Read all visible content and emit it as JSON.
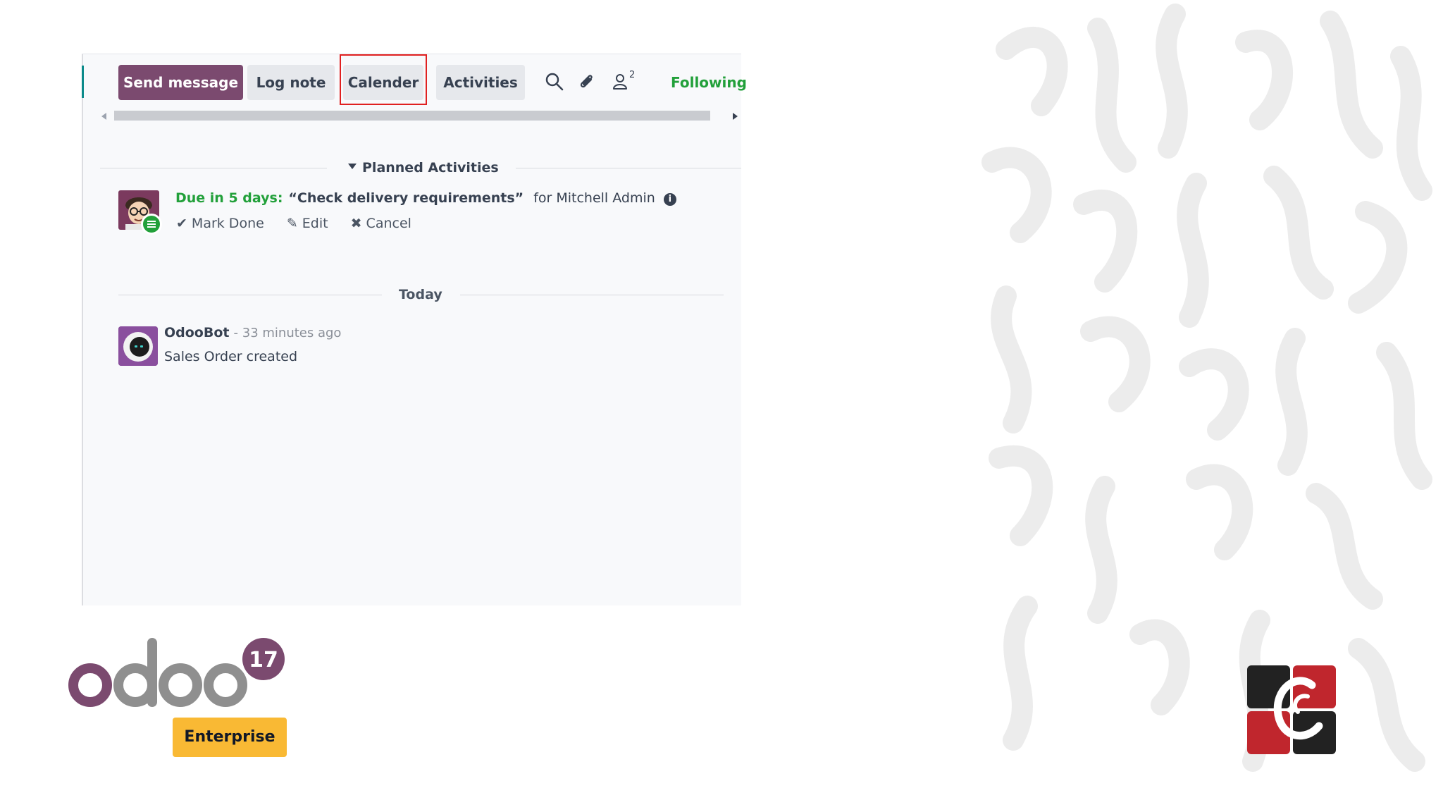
{
  "composer": {
    "send_message": "Send message",
    "log_note": "Log note",
    "calendar": "Calender",
    "activities": "Activities",
    "followers_count": "2",
    "following": "Following"
  },
  "planned": {
    "header": "Planned Activities",
    "activity": {
      "due": "Due in 5 days:",
      "summary": "“Check delivery requirements”",
      "assignee": "for Mitchell Admin",
      "mark_done": "Mark Done",
      "edit": "Edit",
      "cancel": "Cancel"
    }
  },
  "feed": {
    "date_separator": "Today",
    "messages": [
      {
        "author": "OdooBot",
        "time": "- 33 minutes ago",
        "body": "Sales Order created"
      }
    ]
  },
  "branding": {
    "product": "odoo",
    "version": "17",
    "edition": "Enterprise"
  },
  "colors": {
    "primary": "#7b4a6f",
    "success": "#22a03a",
    "highlight": "#e02020",
    "enterprise": "#f9b934"
  }
}
